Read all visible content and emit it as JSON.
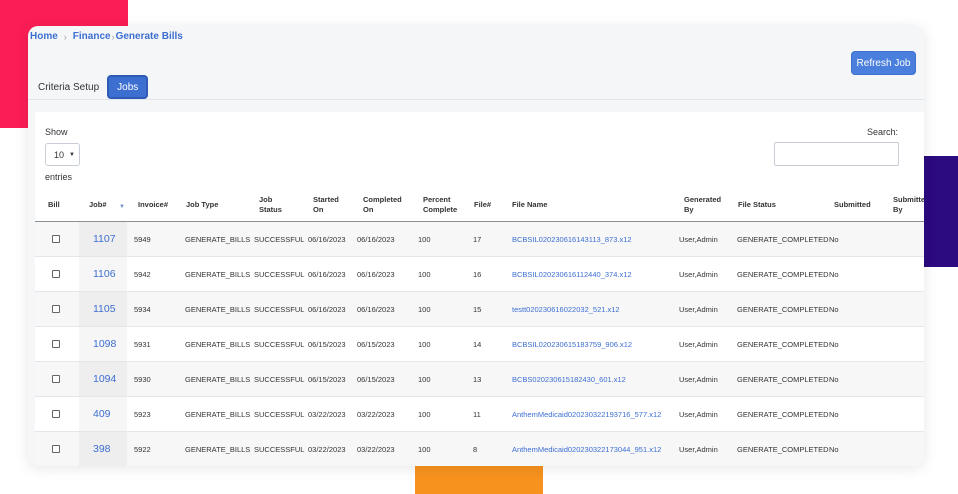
{
  "breadcrumb": {
    "home": "Home",
    "finance": "Finance",
    "current": "Generate Bills"
  },
  "actions": {
    "refresh_label": "Refresh Job"
  },
  "tabs": {
    "criteria": "Criteria Setup",
    "jobs": "Jobs"
  },
  "table_controls": {
    "show_label": "Show",
    "page_length": "10",
    "entries_label": "entries",
    "search_label": "Search:"
  },
  "columns": [
    [
      "Bill"
    ],
    [
      "Job#"
    ],
    [
      "Invoice#"
    ],
    [
      "Job Type"
    ],
    [
      "Job",
      "Status"
    ],
    [
      "Started",
      "On"
    ],
    [
      "Completed",
      "On"
    ],
    [
      "Percent",
      "Complete"
    ],
    [
      "File#"
    ],
    [
      "File Name"
    ],
    [
      "Generated",
      "By"
    ],
    [
      "File Status"
    ],
    [
      "Submitted"
    ],
    [
      "Submitted",
      "By"
    ]
  ],
  "rows": [
    {
      "job": "1107",
      "invoice": "5949",
      "type": "GENERATE_BILLS",
      "status": "SUCCESSFUL",
      "started": "06/16/2023",
      "completed": "06/16/2023",
      "percent": "100",
      "file_no": "17",
      "file_name": "BCBSIL020230616143113_873.x12",
      "generated_by": "User,Admin",
      "file_status": "GENERATE_COMPLETED",
      "submitted": "No"
    },
    {
      "job": "1106",
      "invoice": "5942",
      "type": "GENERATE_BILLS",
      "status": "SUCCESSFUL",
      "started": "06/16/2023",
      "completed": "06/16/2023",
      "percent": "100",
      "file_no": "16",
      "file_name": "BCBSIL020230616112440_374.x12",
      "generated_by": "User,Admin",
      "file_status": "GENERATE_COMPLETED",
      "submitted": "No"
    },
    {
      "job": "1105",
      "invoice": "5934",
      "type": "GENERATE_BILLS",
      "status": "SUCCESSFUL",
      "started": "06/16/2023",
      "completed": "06/16/2023",
      "percent": "100",
      "file_no": "15",
      "file_name": "testt020230616022032_521.x12",
      "generated_by": "User,Admin",
      "file_status": "GENERATE_COMPLETED",
      "submitted": "No"
    },
    {
      "job": "1098",
      "invoice": "5931",
      "type": "GENERATE_BILLS",
      "status": "SUCCESSFUL",
      "started": "06/15/2023",
      "completed": "06/15/2023",
      "percent": "100",
      "file_no": "14",
      "file_name": "BCBSIL020230615183759_906.x12",
      "generated_by": "User,Admin",
      "file_status": "GENERATE_COMPLETED",
      "submitted": "No"
    },
    {
      "job": "1094",
      "invoice": "5930",
      "type": "GENERATE_BILLS",
      "status": "SUCCESSFUL",
      "started": "06/15/2023",
      "completed": "06/15/2023",
      "percent": "100",
      "file_no": "13",
      "file_name": "BCBS020230615182430_601.x12",
      "generated_by": "User,Admin",
      "file_status": "GENERATE_COMPLETED",
      "submitted": "No"
    },
    {
      "job": "409",
      "invoice": "5923",
      "type": "GENERATE_BILLS",
      "status": "SUCCESSFUL",
      "started": "03/22/2023",
      "completed": "03/22/2023",
      "percent": "100",
      "file_no": "11",
      "file_name": "AnthemMedicaid020230322193716_577.x12",
      "generated_by": "User,Admin",
      "file_status": "GENERATE_COMPLETED",
      "submitted": "No"
    },
    {
      "job": "398",
      "invoice": "5922",
      "type": "GENERATE_BILLS",
      "status": "SUCCESSFUL",
      "started": "03/22/2023",
      "completed": "03/22/2023",
      "percent": "100",
      "file_no": "8",
      "file_name": "AnthemMedicaid020230322173044_951.x12",
      "generated_by": "User,Admin",
      "file_status": "GENERATE_COMPLETED",
      "submitted": "No"
    }
  ],
  "colors": {
    "accent": "#3d6fd1",
    "button": "#4a7fdd",
    "deco_red": "#fb1d55",
    "deco_purple": "#2c0a7f",
    "deco_orange": "#f7921e"
  }
}
